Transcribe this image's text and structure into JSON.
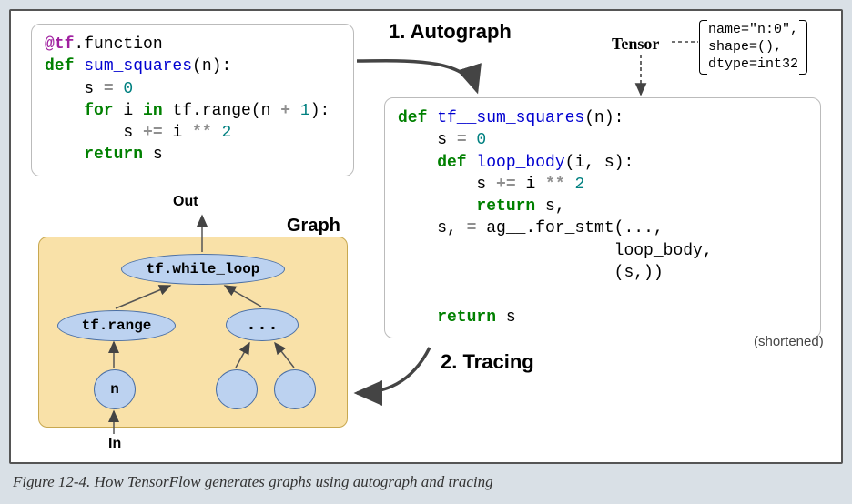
{
  "caption": "Figure 12-4. How TensorFlow generates graphs using autograph and tracing",
  "steps": {
    "autograph": "1.  Autograph",
    "tracing": "2.  Tracing"
  },
  "tensor_label": "Tensor",
  "tensor_info": "name=\"n:0\",\nshape=(),\ndtype=int32",
  "graph_label": "Graph",
  "shortened_label": "(shortened)",
  "source_code": {
    "decorator_at": "@tf",
    "decorator_rest": ".function",
    "def_kw": "def",
    "fn_name": "sum_squares",
    "fn_params": "(n):",
    "assign_s": "    s ",
    "eq": "=",
    "zero": " 0",
    "for_kw": "    for",
    "for_mid": " i ",
    "in_kw": "in",
    "range_call": " tf.range(n ",
    "plus": "+",
    "one": " 1",
    "range_end": "):",
    "s_inc": "        s ",
    "pluseq": "+=",
    "i_part": " i ",
    "starstar": "**",
    "two": " 2",
    "return_kw": "    return",
    "return_s": " s"
  },
  "autograph_code": {
    "def_kw": "def",
    "fn_name": " tf__sum_squares",
    "fn_params": "(n):",
    "assign_s": "    s ",
    "eq": "=",
    "zero": " 0",
    "inner_def_kw": "    def",
    "inner_fn": " loop_body",
    "inner_params": "(i, s):",
    "s_inc": "        s ",
    "pluseq": "+=",
    "i_part": " i ",
    "starstar": "**",
    "two": " 2",
    "inner_ret_kw": "        return",
    "inner_ret_s": " s,",
    "outer_assign": "    s, ",
    "eq2": "=",
    "ag_call": " ag__.for_stmt(...,",
    "ag_line2": "                      loop_body,",
    "ag_line3": "                      (s,))",
    "return_kw": "    return",
    "return_s": " s"
  },
  "graph_nodes": {
    "while_loop": "tf.while_loop",
    "range": "tf.range",
    "dots": "...",
    "n": "n"
  },
  "io_labels": {
    "out": "Out",
    "in": "In"
  }
}
